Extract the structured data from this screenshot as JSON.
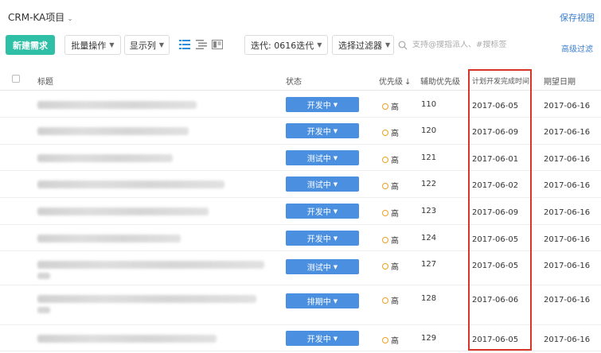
{
  "header": {
    "project_title": "CRM-KA项目",
    "save_view": "保存视图"
  },
  "toolbar": {
    "new_button": "新建需求",
    "batch_ops": "批量操作",
    "show_columns": "显示列",
    "iteration_label": "迭代: 0616迭代",
    "filter_label": "选择过滤器",
    "search_placeholder": "支持@搜指派人、#搜标签",
    "advanced_filter": "高级过滤"
  },
  "table": {
    "columns": {
      "title": "标题",
      "status": "状态",
      "priority": "优先级",
      "sub_priority": "辅助优先级",
      "planned_date": "计划开发完成时间",
      "expected_date": "期望日期"
    },
    "rows": [
      {
        "status": "开发中",
        "priority": "高",
        "sub_priority": "110",
        "planned": "2017-06-05",
        "expected": "2017-06-16"
      },
      {
        "status": "开发中",
        "priority": "高",
        "sub_priority": "120",
        "planned": "2017-06-09",
        "expected": "2017-06-16"
      },
      {
        "status": "测试中",
        "priority": "高",
        "sub_priority": "121",
        "planned": "2017-06-01",
        "expected": "2017-06-16"
      },
      {
        "status": "测试中",
        "priority": "高",
        "sub_priority": "122",
        "planned": "2017-06-02",
        "expected": "2017-06-16"
      },
      {
        "status": "开发中",
        "priority": "高",
        "sub_priority": "123",
        "planned": "2017-06-09",
        "expected": "2017-06-16"
      },
      {
        "status": "开发中",
        "priority": "高",
        "sub_priority": "124",
        "planned": "2017-06-05",
        "expected": "2017-06-16"
      },
      {
        "status": "测试中",
        "priority": "高",
        "sub_priority": "127",
        "planned": "2017-06-05",
        "expected": "2017-06-16"
      },
      {
        "status": "排期中",
        "priority": "高",
        "sub_priority": "128",
        "planned": "2017-06-06",
        "expected": "2017-06-16"
      },
      {
        "status": "开发中",
        "priority": "高",
        "sub_priority": "129",
        "planned": "2017-06-05",
        "expected": "2017-06-16"
      }
    ]
  },
  "colors": {
    "accent_green": "#2ebfa6",
    "status_blue": "#4a8fe0",
    "priority_orange": "#f0a020",
    "highlight_red": "#d8352a",
    "link_blue": "#3b7fd0"
  }
}
